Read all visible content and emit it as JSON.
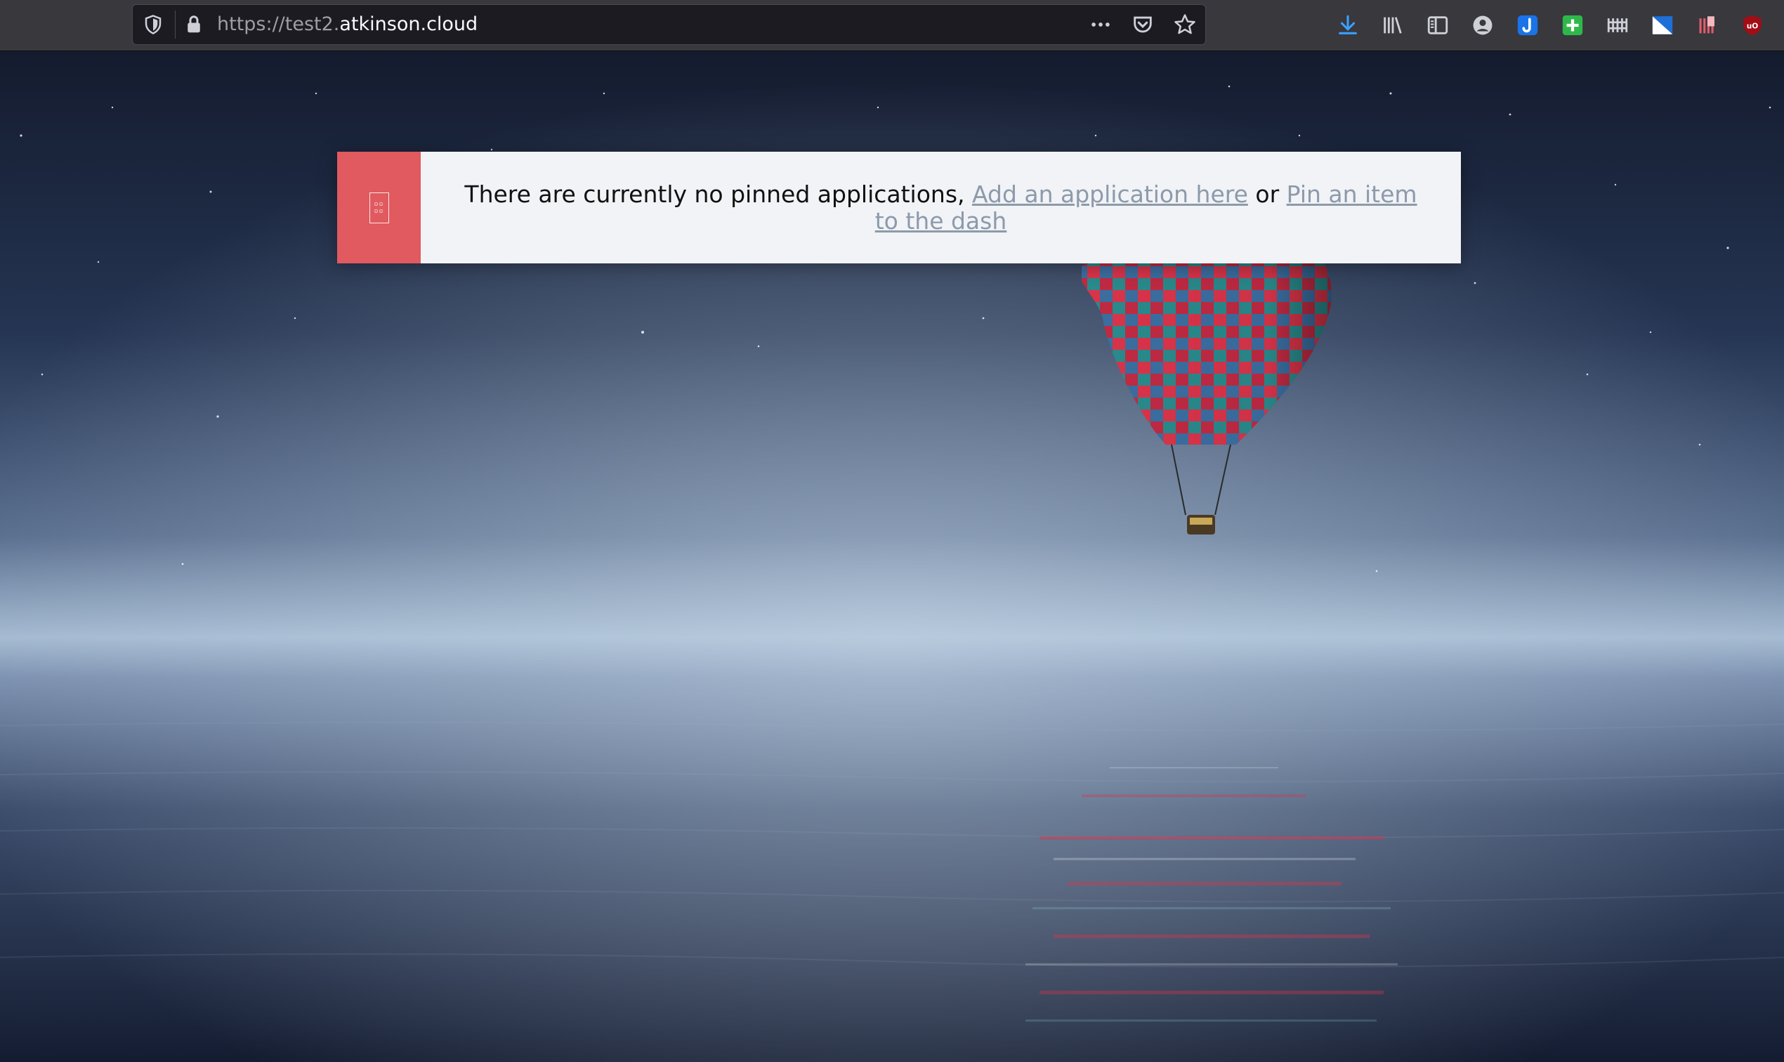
{
  "browser": {
    "url_protocol": "https://",
    "url_subdomain": "test2.",
    "url_domain": "atkinson.cloud",
    "url_actions": [
      "more-actions-icon",
      "pocket-icon",
      "bookmark-star-icon"
    ],
    "toolbar_icons": [
      "download-icon",
      "library-icon",
      "sidebar-icon",
      "account-icon",
      "joplin-extension-icon",
      "plus-extension-icon",
      "bar-extension-icon",
      "flag-extension-icon",
      "bookmark-extension-icon",
      "ublock-icon"
    ]
  },
  "notice": {
    "badge_icon": "app-grid-icon",
    "badge_color": "#e05a5f",
    "message": "There are currently no pinned applications, ",
    "add_link": "Add an application here",
    "connector": " or ",
    "pin_link": "Pin an item to the dash"
  },
  "colors": {
    "toolbar_bg": "#38383d",
    "notice_bg": "#f1f3f6",
    "link": "#8d9aab"
  }
}
